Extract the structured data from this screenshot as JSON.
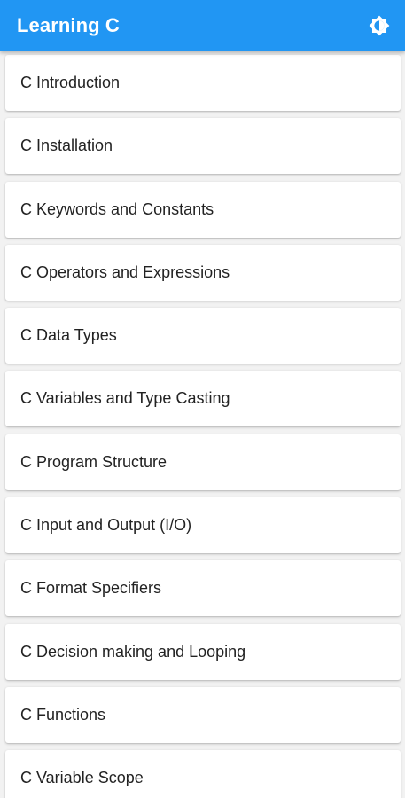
{
  "app_bar": {
    "title": "Learning C",
    "theme_icon": "brightness-icon",
    "background_color": "#2196f3"
  },
  "topics": [
    {
      "label": "C Introduction"
    },
    {
      "label": "C Installation"
    },
    {
      "label": "C Keywords and Constants"
    },
    {
      "label": "C Operators and Expressions"
    },
    {
      "label": "C Data Types"
    },
    {
      "label": "C Variables and Type Casting"
    },
    {
      "label": "C Program Structure"
    },
    {
      "label": "C Input and Output (I/O)"
    },
    {
      "label": "C Format Specifiers"
    },
    {
      "label": "C Decision making and Looping"
    },
    {
      "label": "C Functions"
    },
    {
      "label": "C Variable Scope"
    }
  ]
}
